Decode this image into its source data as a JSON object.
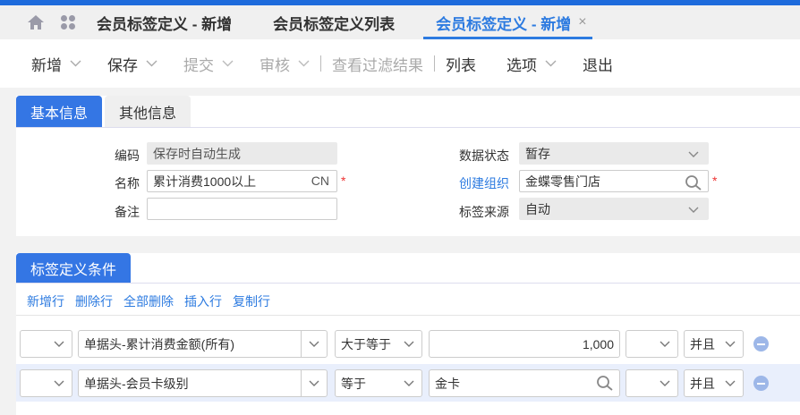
{
  "tabs": [
    {
      "label": "会员标签定义 - 新增"
    },
    {
      "label": "会员标签定义列表"
    },
    {
      "label": "会员标签定义 - 新增",
      "close": "×"
    }
  ],
  "toolbar": {
    "new": "新增",
    "save": "保存",
    "submit": "提交",
    "audit": "审核",
    "view_filter": "查看过滤结果",
    "list": "列表",
    "options": "选项",
    "exit": "退出"
  },
  "panel_tabs": {
    "basic": "基本信息",
    "other": "其他信息"
  },
  "form": {
    "code_label": "编码",
    "code_value": "保存时自动生成",
    "name_label": "名称",
    "name_value": "累计消费1000以上",
    "name_lang": "CN",
    "required": "*",
    "remark_label": "备注",
    "remark_value": "",
    "status_label": "数据状态",
    "status_value": "暂存",
    "org_label": "创建组织",
    "org_value": "金蝶零售门店",
    "source_label": "标签来源",
    "source_value": "自动"
  },
  "conditions": {
    "tab": "标签定义条件",
    "actions": [
      "新增行",
      "删除行",
      "全部删除",
      "插入行",
      "复制行"
    ],
    "rows": [
      {
        "field": "单据头-累计消费金额(所有)",
        "op": "大于等于",
        "value": "1,000",
        "logic": "并且"
      },
      {
        "field": "单据头-会员卡级别",
        "op": "等于",
        "value": "金卡",
        "logic": "并且"
      }
    ]
  },
  "colors": {
    "accent": "#2d7be0",
    "tab_active": "#3476e4",
    "required": "#ee3333"
  }
}
